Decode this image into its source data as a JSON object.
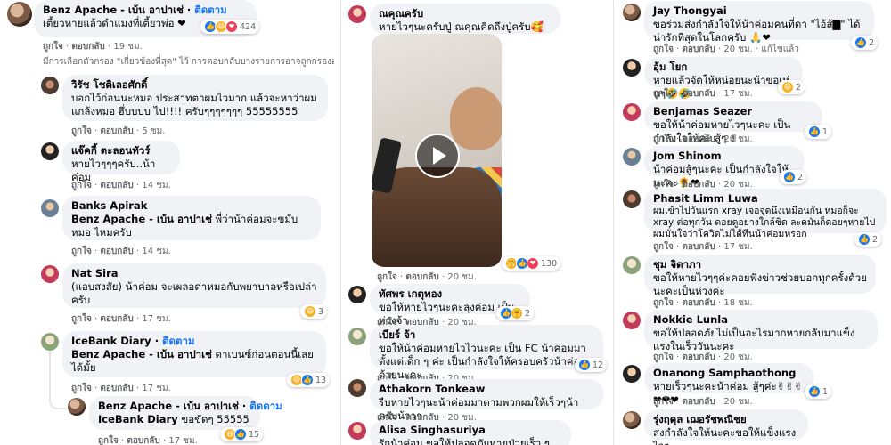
{
  "col1": {
    "comments": [
      {
        "name": "Benz Apache - เบ้น อาปาเช่",
        "follow": "ติดตาม",
        "text": "เตี้ยวหายแล้วดำแมงที่เตี้ยวพ่อ ❤",
        "like": "ถูกใจ",
        "reply": "ตอบกลับ",
        "time": "19 ชม.",
        "reactions": "424"
      },
      {
        "name": "วิรัช โชติเลอศักดิ์",
        "text": "บอกไว้ก่อนนะหมอ ประสาทตาผมไวมาก แล้วจะหาว่าผมแกล้งหมอ ฮึ่บบบบ ไป!!!! ครับๆๆๆๆๆๆๆ 55555555",
        "like": "ถูกใจ",
        "reply": "ตอบกลับ",
        "time": "5 ชม."
      },
      {
        "name": "แจ๊คกี้ ตะลอนทัวร์",
        "text": "หายไวๆๆๆครับ..น้าค่อม",
        "like": "ถูกใจ",
        "reply": "ตอบกลับ",
        "time": "14 ชม."
      },
      {
        "name": "Banks Apirak",
        "tag": "Benz Apache - เบ้น อาปาเช่",
        "text": "พี่ว่าน้าค่อมจะขมับหมอ ไหมครับ",
        "like": "ถูกใจ",
        "reply": "ตอบกลับ",
        "time": "14 ชม."
      },
      {
        "name": "Nat Sira",
        "text": "(แอบสงสัย) น้าค่อม จะเผลอด่าหมอกับพยาบาลหรือเปล่าครับ",
        "like": "ถูกใจ",
        "reply": "ตอบกลับ",
        "time": "17 ชม.",
        "reactions": "3"
      },
      {
        "name": "IceBank Diary",
        "follow": "ติดตาม",
        "tag": "Benz Apache - เบ้น อาปาเช่",
        "text": "ดาเบนซ์ก่อนตอนนี้เลยได้มั้ย",
        "like": "ถูกใจ",
        "reply": "ตอบกลับ",
        "time": "17 ชม.",
        "reactions": "13"
      },
      {
        "name": "Benz Apache - เบ้น อาปาเช่",
        "follow": "ติดตาม",
        "tag": "IceBank Diary",
        "text": "ขอขัดๆ 55555",
        "like": "ถูกใจ",
        "reply": "ตอบกลับ",
        "time": "17 ชม.",
        "reactions": "15"
      }
    ],
    "note": "มีการเลือกตัวกรอง \"เกี่ยวข้องที่สุด\" ไว้ การตอบกลับบางรายการอาจถูกกรองออก"
  },
  "col2": {
    "comments": [
      {
        "name": "ณคุณครับ",
        "text": "หายไวๆนะครับปู่ ณคุณคิดถึงปู่ครับ🥰🙏🥰🙏"
      },
      {
        "name": "",
        "like": "ถูกใจ",
        "reply": "ตอบกลับ",
        "time": "20 ชม.",
        "reactions": "130"
      },
      {
        "name": "ทัศพร เกตุทอง",
        "text": "ขอให้หายไวๆนะคะลุงค่อม เป็นห่วงจ้า",
        "like": "ถูกใจ",
        "reply": "ตอบกลับ",
        "time": "20 ชม.",
        "reactions": "2"
      },
      {
        "name": "เบียร์ จ้า",
        "text": "ขอให้น้าค่อมหายไวไวนะคะ เป็น FC น้าค่อมมาตั้งแต่เด็ก ๆ ค่ะ เป็นกำลังใจให้ครอบครัวน้าค่อมด้วยนะคะ",
        "like": "ถูกใจ",
        "reply": "ตอบกลับ",
        "time": "20 ชม.",
        "reactions": "12"
      },
      {
        "name": "Athakorn Tonkeaw",
        "text": "รีบหายไวๆนะน้าค่อมมาตามพวกผมให้เร็วๆน้าครับน้าาา",
        "like": "ถูกใจ",
        "reply": "ตอบกลับ",
        "time": "20 ชม."
      },
      {
        "name": "Alisa Singhasuriya",
        "text": "รักน้าค่อม ขอให้ปลอดภัยหายป่วยเร็ว ๆ นะคะ"
      }
    ]
  },
  "col3": {
    "comments": [
      {
        "name": "Jay Thongyai",
        "text": "ขอร่วมส่งกำลังใจให้น้าค่อมคนที่ดา \"ไอ้ส้▇\" ได้น่ารักที่สุดในโลกครับ 🙏❤",
        "like": "ถูกใจ",
        "reply": "ตอบกลับ",
        "time": "20 ชม.",
        "edited": "แก้ไขแล้ว",
        "reactions": "2"
      },
      {
        "name": "อุ้ม โยก",
        "text": "หายแล้วจัดให้หน่อยนะน้าขอเห่นๆ🤣🤣",
        "like": "ถูกใจ",
        "reply": "ตอบกลับ",
        "time": "17 ชม.",
        "reactions": "2"
      },
      {
        "name": "Benjamas Seazer",
        "text": "ขอให้น้าค่อมหายไวๆนะคะ เป็นกำลังใจให้ค่ะ สู้ๆ ✌",
        "like": "ถูกใจ",
        "reply": "ตอบกลับ",
        "time": "20 ชม.",
        "reactions": "1"
      },
      {
        "name": "Jom Shinom",
        "text": "น้าค่อมสู้ๆนะคะ เป็นกำลังใจให้นะคะ🌻❤",
        "like": "ถูกใจ",
        "reply": "ตอบกลับ",
        "time": "20 ชม.",
        "reactions": "2"
      },
      {
        "name": "Phasit Limm Luwa",
        "text": "ผมเข้าไปวันแรก xray เจอจุดนึงเหมือนกัน หมอก็จะ xray ต่อทุกวัน ดอยดูอย่างใกล้ชิด ละดมันก็ดอยๆหายไป ผมมั่นใจว่าโควิดไม่ได้ทีนน้าค่อมหรอก",
        "like": "ถูกใจ",
        "reply": "ตอบกลับ",
        "time": "17 ชม.",
        "reactions": "2"
      },
      {
        "name": "ชุม จิดาภา",
        "text": "ขอให้หายไวๆๆค่ะคอยฟังข่าวช่วยบอกทุกครั้งด้วยนะคะเป็นห่วงค่ะ",
        "like": "ถูกใจ",
        "reply": "ตอบกลับ",
        "time": "18 ชม."
      },
      {
        "name": "Nokkie Lunla",
        "text": "ขอให้ปลอดภัยไม่เป็นอะไรมากหายกลับมาแข็งแรงในเร็ววันนะคะ",
        "like": "ถูกใจ",
        "reply": "ตอบกลับ",
        "time": "20 ชม."
      },
      {
        "name": "Onanong Samphaothong",
        "text": "หายเร็วๆนะคะน้าค่อม สู้ๆค่ะ✌✌✌❤❤❤",
        "like": "ถูกใจ",
        "reply": "ตอบกลับ",
        "time": "20 ชม.",
        "reactions": "1"
      },
      {
        "name": "รุ่งฤดุล เฌอรัชพณิชย",
        "text": "ส่งกำลังใจให้นะคะขอให้แข็งแรงไวๆ"
      }
    ]
  },
  "colors": {
    "link": "#1877f2",
    "bubble": "#f0f2f5",
    "muted": "#65676b",
    "like": "#1877f2",
    "love": "#f33e58",
    "haha": "#f7b125"
  }
}
